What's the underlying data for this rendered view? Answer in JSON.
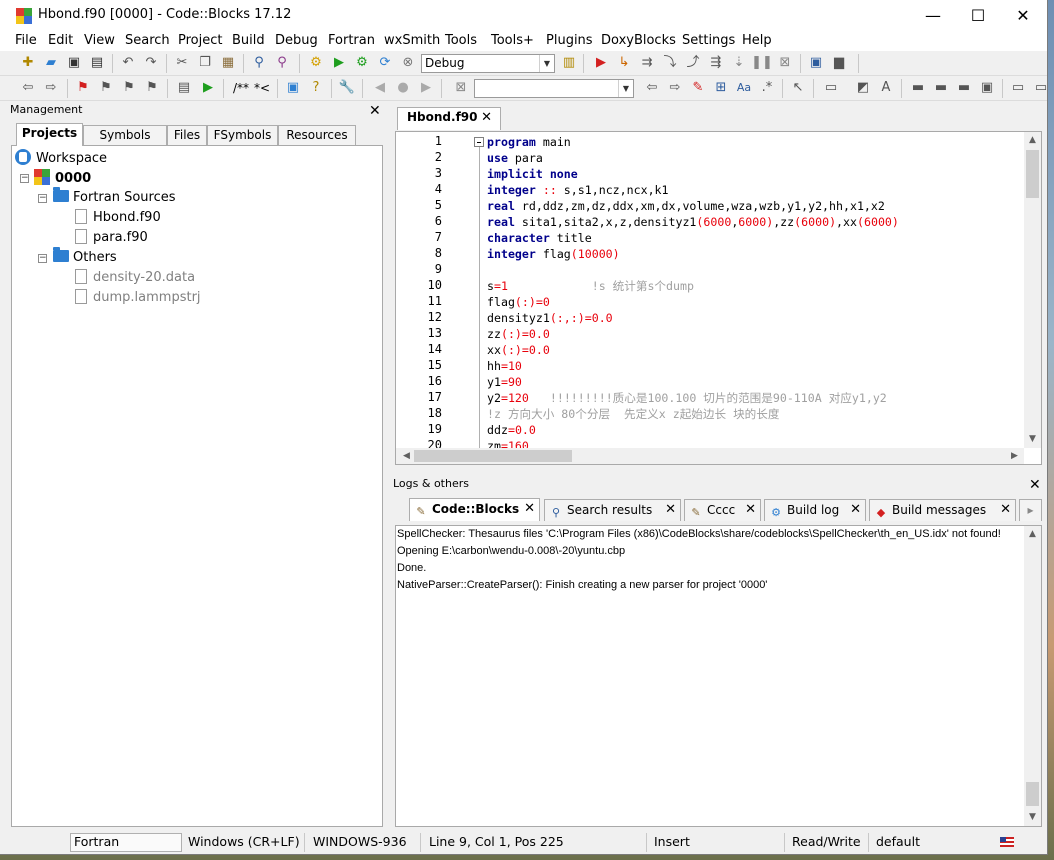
{
  "window": {
    "title": "Hbond.f90 [0000] - Code::Blocks 17.12",
    "controls": {
      "minimize": "—",
      "maximize": "☐",
      "close": "✕"
    }
  },
  "menu": [
    "File",
    "Edit",
    "View",
    "Search",
    "Project",
    "Build",
    "Debug",
    "Fortran",
    "wxSmith",
    "Tools",
    "Tools+",
    "Plugins",
    "DoxyBlocks",
    "Settings",
    "Help"
  ],
  "toolbar": {
    "build_target": "Debug",
    "doxy_comment_block": "/**",
    "doxy_comment_line": "*<"
  },
  "management": {
    "title": "Management",
    "tabs": [
      "Projects",
      "Symbols",
      "Files",
      "FSymbols",
      "Resources"
    ],
    "active_tab": "Projects",
    "tree": {
      "workspace": "Workspace",
      "project": "0000",
      "fortran_sources": "Fortran Sources",
      "sources": [
        "Hbond.f90",
        "para.f90"
      ],
      "others": "Others",
      "other_files": [
        "density-20.data",
        "dump.lammpstrj"
      ]
    }
  },
  "editor": {
    "tab": "Hbond.f90",
    "line_numbers": [
      "1",
      "2",
      "3",
      "4",
      "5",
      "6",
      "7",
      "8",
      "9",
      "10",
      "11",
      "12",
      "13",
      "14",
      "15",
      "16",
      "17",
      "18",
      "19",
      "20"
    ]
  },
  "logs": {
    "title": "Logs & others",
    "tabs": [
      "Code::Blocks",
      "Search results",
      "Cccc",
      "Build log",
      "Build messages"
    ],
    "active_tab": "Code::Blocks",
    "lines": [
      "SpellChecker: Thesaurus files 'C:\\Program Files (x86)\\CodeBlocks\\share/codeblocks\\SpellChecker\\th_en_US.idx' not found!",
      "Opening E:\\carbon\\wendu-0.008\\-20\\yuntu.cbp",
      "Done.",
      "NativeParser::CreateParser(): Finish creating a new parser for project '0000'"
    ]
  },
  "status": {
    "language": "Fortran",
    "eol": "Windows (CR+LF)",
    "encoding": "WINDOWS-936",
    "position": "Line 9, Col 1, Pos 225",
    "mode": "Insert",
    "access": "Read/Write",
    "profile": "default"
  },
  "colors": {
    "keyword": "#00008b",
    "number": "#e8000b",
    "comment": "#a0a0a0"
  }
}
